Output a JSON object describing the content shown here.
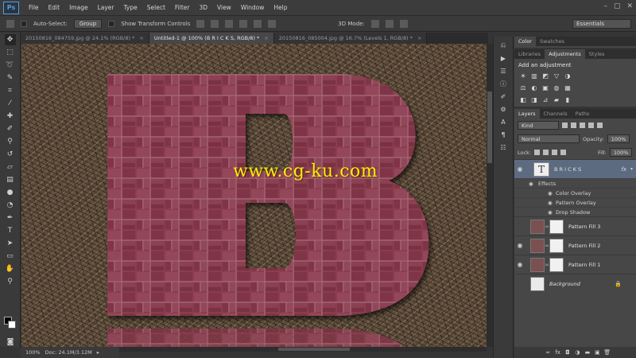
{
  "app": {
    "logo": "Ps"
  },
  "menu": [
    "File",
    "Edit",
    "Image",
    "Layer",
    "Type",
    "Select",
    "Filter",
    "3D",
    "View",
    "Window",
    "Help"
  ],
  "window_controls": [
    "–",
    "▢",
    "✕"
  ],
  "options": {
    "auto_select_label": "Auto-Select:",
    "auto_select_value": "Group",
    "transform_label": "Show Transform Controls",
    "mode_3d_label": "3D Mode:",
    "workspace": "Essentials"
  },
  "tabs": [
    {
      "label": "20150816_084759.jpg @ 24.1% (RGB/8) *",
      "active": false
    },
    {
      "label": "Untitled-1 @ 100% (B R I C K S, RGB/8) *",
      "active": true
    },
    {
      "label": "20150816_085004.jpg @ 16.7% (Levels 1, RGB/8) *",
      "active": false
    }
  ],
  "canvas": {
    "watermark": "www.cg-ku.com",
    "letter": "B",
    "brick_color": "#8a3d4e",
    "background_description_color": "#5b4a39"
  },
  "status": {
    "zoom": "100%",
    "doc": "Doc: 24.1M/3.12M"
  },
  "color_panel": {
    "tabs": [
      "Color",
      "Swatches"
    ]
  },
  "adjustments_panel": {
    "tabs": [
      "Libraries",
      "Adjustments",
      "Styles"
    ],
    "title": "Add an adjustment",
    "row1": [
      "☀",
      "▥",
      "◩",
      "▽",
      "◑"
    ],
    "row2": [
      "⚖",
      "◐",
      "▣",
      "◍",
      "▦"
    ],
    "row3": [
      "◧",
      "◨",
      "⊿",
      "▰",
      "▮"
    ]
  },
  "layers_panel": {
    "tabs": [
      "Layers",
      "Channels",
      "Paths"
    ],
    "kind": "Kind",
    "blend_mode": "Normal",
    "opacity_label": "Opacity:",
    "opacity_value": "100%",
    "lock_label": "Lock:",
    "fill_label": "Fill:",
    "fill_value": "100%",
    "layers": [
      {
        "name": "B R I C K S",
        "type": "text",
        "selected": true,
        "fx": "fx"
      },
      {
        "name": "Pattern Fill 3",
        "type": "pattern",
        "visible": false
      },
      {
        "name": "Pattern Fill 2",
        "type": "pattern",
        "visible": true
      },
      {
        "name": "Pattern Fill 1",
        "type": "pattern",
        "visible": true
      },
      {
        "name": "Background",
        "type": "background",
        "visible": false
      }
    ],
    "effects_label": "Effects",
    "effects": [
      "Color Overlay",
      "Pattern Overlay",
      "Drop Shadow"
    ]
  }
}
